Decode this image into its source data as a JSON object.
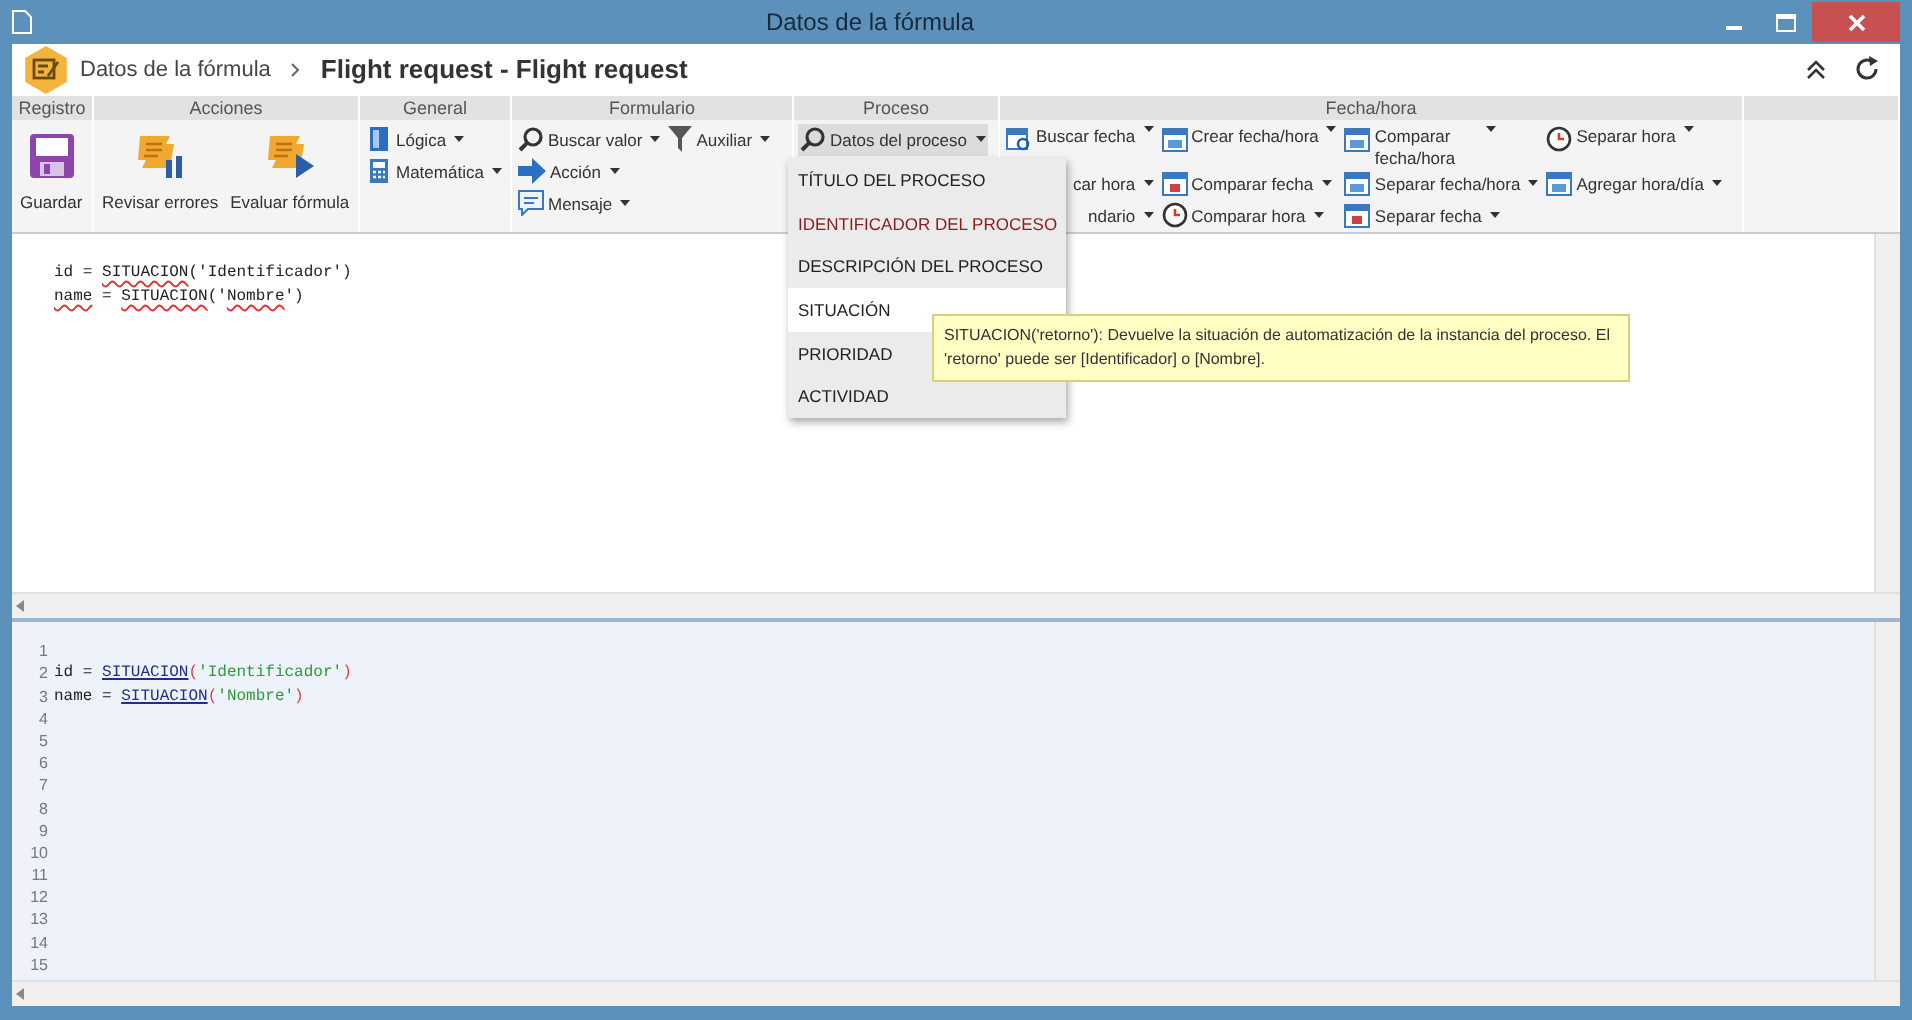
{
  "window": {
    "title": "Datos de la fórmula"
  },
  "breadcrumb": {
    "parent": "Datos de la fórmula",
    "current": "Flight request - Flight request"
  },
  "ribbon": {
    "groups": [
      {
        "title": "Registro",
        "columns": [
          [
            {
              "label": "Guardar",
              "kind": "large"
            }
          ]
        ]
      },
      {
        "title": "Acciones",
        "columns": [
          [
            {
              "label": "Revisar errores",
              "kind": "large"
            }
          ],
          [
            {
              "label": "Evaluar fórmula",
              "kind": "large"
            }
          ]
        ]
      },
      {
        "title": "General",
        "columns": [
          [
            {
              "label": "Lógica",
              "kind": "dropdown"
            },
            {
              "label": "Matemática",
              "kind": "dropdown"
            }
          ]
        ]
      },
      {
        "title": "Formulario",
        "columns": [
          [
            {
              "label": "Buscar valor",
              "kind": "dropdown"
            },
            {
              "label": "Acción",
              "kind": "dropdown"
            },
            {
              "label": "Mensaje",
              "kind": "dropdown"
            }
          ],
          [
            {
              "label": "Auxiliar",
              "kind": "dropdown"
            }
          ]
        ]
      },
      {
        "title": "Proceso",
        "columns": [
          [
            {
              "label": "Datos del proceso",
              "kind": "dropdown",
              "expanded": true
            }
          ]
        ]
      },
      {
        "title": "Fecha/hora",
        "columns": [
          [
            {
              "label": "Buscar fecha",
              "kind": "dropdown"
            },
            {
              "label": "car hora",
              "kind": "covered"
            },
            {
              "label": "ndario",
              "kind": "covered"
            }
          ],
          [
            {
              "label": "Crear fecha/hora",
              "kind": "dropdown"
            },
            {
              "label": "Comparar fecha",
              "kind": "dropdown"
            },
            {
              "label": "Comparar hora",
              "kind": "dropdown"
            }
          ],
          [
            {
              "label": "Comparar fecha/hora",
              "kind": "wrapped"
            },
            {
              "label": "Separar fecha/hora",
              "kind": "dropdown"
            },
            {
              "label": "Separar fecha",
              "kind": "dropdown"
            }
          ],
          [
            {
              "label": "Separar hora",
              "kind": "dropdown"
            },
            {
              "label": "Agregar hora/día",
              "kind": "dropdown"
            }
          ]
        ]
      }
    ]
  },
  "process_menu": {
    "items": [
      {
        "label": "TÍTULO DEL PROCESO",
        "selected": false,
        "color": "#222222"
      },
      {
        "label": "IDENTIFICADOR DEL PROCESO",
        "selected": false,
        "color": "#8b1c1c"
      },
      {
        "label": "DESCRIPCIÓN DEL PROCESO",
        "selected": false,
        "color": "#222222"
      },
      {
        "label": "SITUACIÓN",
        "selected": true,
        "color": "#222222"
      },
      {
        "label": "PRIORIDAD",
        "selected": false,
        "color": "#222222"
      },
      {
        "label": "ACTIVIDAD",
        "selected": false,
        "color": "#222222"
      }
    ]
  },
  "tooltip": {
    "text": "SITUACION('retorno'): Devuelve la situación de automatización de la instancia del proceso. El 'retorno' puede ser [Identificador] o [Nombre]."
  },
  "formula_editor": {
    "lines": [
      [
        {
          "text": "id",
          "misspelled": false
        },
        {
          "text": " = ",
          "misspelled": false
        },
        {
          "text": "SITUACION",
          "misspelled": true
        },
        {
          "text": "('Identificador')",
          "misspelled": false
        }
      ],
      [
        {
          "text": "name",
          "misspelled": true
        },
        {
          "text": " = ",
          "misspelled": false
        },
        {
          "text": "SITUACION",
          "misspelled": true
        },
        {
          "text": "('",
          "misspelled": false
        },
        {
          "text": "Nombre",
          "misspelled": true
        },
        {
          "text": "')",
          "misspelled": false
        }
      ]
    ]
  },
  "preview": {
    "lines": [
      {
        "number": "1"
      },
      {
        "number": "2",
        "tokens": [
          {
            "text": "id",
            "kind": "ident"
          },
          {
            "text": " = ",
            "kind": "op"
          },
          {
            "text": "SITUACION",
            "kind": "func"
          },
          {
            "text": "(",
            "kind": "paren"
          },
          {
            "text": "'Identificador'",
            "kind": "string"
          },
          {
            "text": ")",
            "kind": "paren"
          }
        ]
      },
      {
        "number": "3",
        "tokens": [
          {
            "text": "name",
            "kind": "ident"
          },
          {
            "text": " = ",
            "kind": "op"
          },
          {
            "text": "SITUACION",
            "kind": "func"
          },
          {
            "text": "(",
            "kind": "paren"
          },
          {
            "text": "'Nombre'",
            "kind": "string"
          },
          {
            "text": ")",
            "kind": "paren"
          }
        ]
      },
      {
        "number": "4"
      },
      {
        "number": "5"
      },
      {
        "number": "6"
      },
      {
        "number": "7"
      },
      {
        "number": "8"
      },
      {
        "number": "9"
      },
      {
        "number": "10"
      },
      {
        "number": "11"
      },
      {
        "number": "12"
      },
      {
        "number": "13"
      },
      {
        "number": "14"
      },
      {
        "number": "15"
      }
    ]
  }
}
